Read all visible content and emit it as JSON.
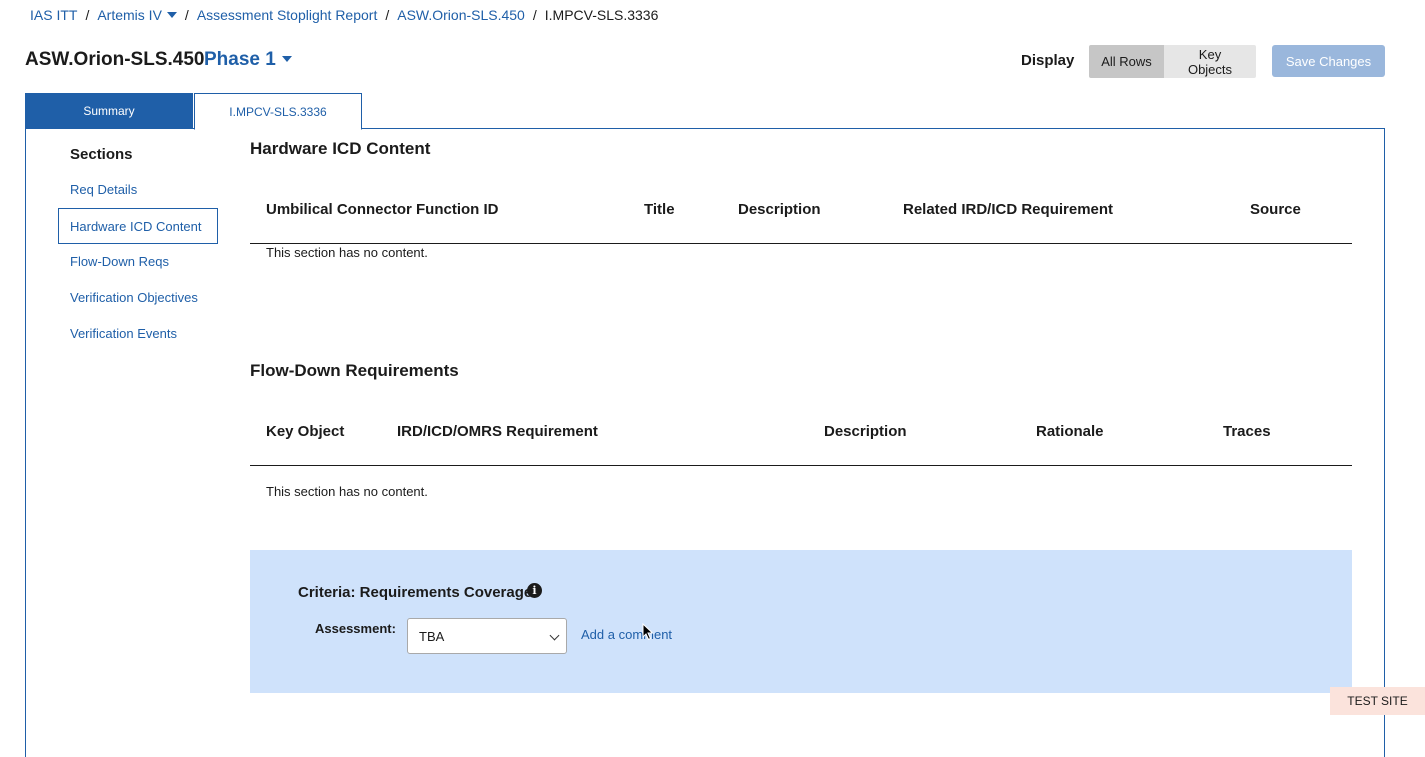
{
  "breadcrumb": {
    "items": [
      {
        "label": "IAS ITT"
      },
      {
        "label": "Artemis IV"
      },
      {
        "label": "Assessment Stoplight Report"
      },
      {
        "label": "ASW.Orion-SLS.450"
      }
    ],
    "current": "I.MPCV-SLS.3336",
    "separator": "/"
  },
  "header": {
    "title": "ASW.Orion-SLS.450",
    "phase": "Phase 1",
    "display_label": "Display",
    "display_options": [
      "All Rows",
      "Key Objects"
    ],
    "display_selected": "All Rows",
    "save_label": "Save Changes"
  },
  "tabs": [
    {
      "label": "Summary",
      "active": false
    },
    {
      "label": "I.MPCV-SLS.3336",
      "active": true
    }
  ],
  "sidebar": {
    "title": "Sections",
    "items": [
      {
        "label": "Req Details"
      },
      {
        "label": "Hardware ICD Content",
        "selected": true
      },
      {
        "label": "Flow-Down Reqs"
      },
      {
        "label": "Verification Objectives"
      },
      {
        "label": "Verification Events"
      }
    ]
  },
  "hardware_icd": {
    "title": "Hardware ICD Content",
    "columns": [
      "Umbilical Connector Function ID",
      "Title",
      "Description",
      "Related IRD/ICD Requirement",
      "Source"
    ],
    "empty_text": "This section has no content."
  },
  "flow_down": {
    "title": "Flow-Down Requirements",
    "columns": [
      "Key Object",
      "IRD/ICD/OMRS Requirement",
      "Description",
      "Rationale",
      "Traces"
    ],
    "empty_text": "This section has no content."
  },
  "criteria": {
    "title": "Criteria: Requirements Coverage",
    "info_icon": "i",
    "assessment_label": "Assessment:",
    "assessment_value": "TBA",
    "add_comment": "Add a comment"
  },
  "environment_badge": "TEST SITE",
  "colors": {
    "link": "#1f5fa8",
    "criteria_bg": "#cfe2fb",
    "save_disabled": "#9ab7dc",
    "test_badge": "#fbe3dc"
  }
}
